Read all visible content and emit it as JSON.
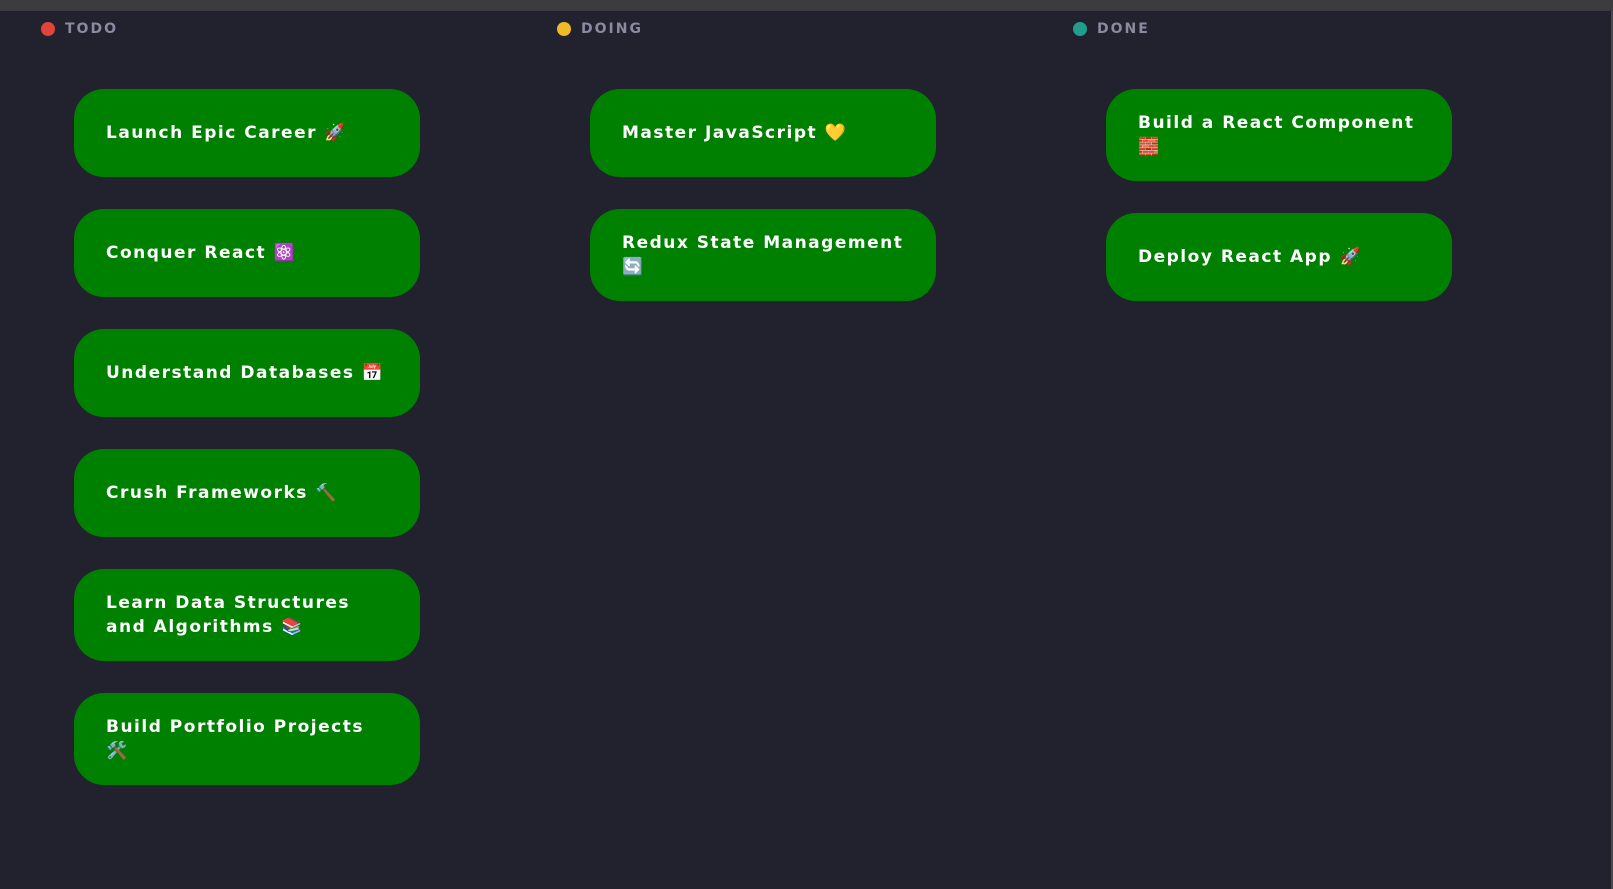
{
  "colors": {
    "background": "#22212e",
    "card": "#008000",
    "todo_dot": "#e0443a",
    "doing_dot": "#f0b92a",
    "done_dot": "#1f9e8e",
    "header_text": "#8a8aa0"
  },
  "columns": [
    {
      "title": "TODO",
      "dot_color": "#e0443a",
      "cards": [
        {
          "label": "Launch Epic Career 🚀"
        },
        {
          "label": "Conquer React ⚛️"
        },
        {
          "label": "Understand Databases 📅"
        },
        {
          "label": "Crush Frameworks 🔨"
        },
        {
          "label": "Learn Data Structures and Algorithms 📚"
        },
        {
          "label": "Build Portfolio Projects 🛠️"
        }
      ]
    },
    {
      "title": "DOING",
      "dot_color": "#f0b92a",
      "cards": [
        {
          "label": "Master JavaScript 💛"
        },
        {
          "label": "Redux State Management 🔄"
        }
      ]
    },
    {
      "title": "DONE",
      "dot_color": "#1f9e8e",
      "cards": [
        {
          "label": "Build a React Component 🧱"
        },
        {
          "label": "Deploy React App 🚀"
        }
      ]
    }
  ]
}
